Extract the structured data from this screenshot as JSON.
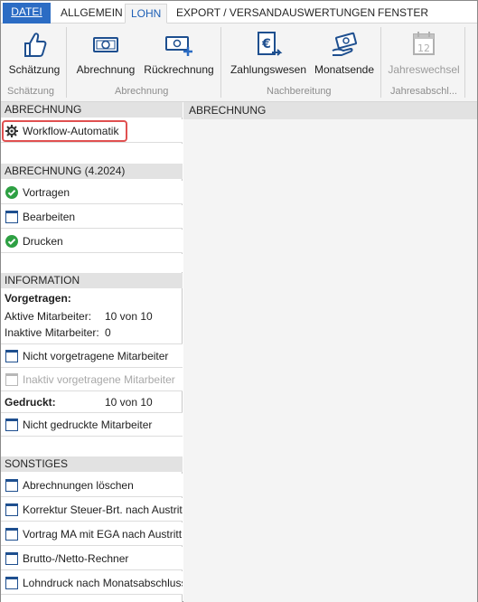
{
  "menu": {
    "tabs": [
      "DATEI",
      "ALLGEMEIN",
      "LOHN",
      "EXPORT / VERSAND",
      "AUSWERTUNGEN",
      "FENSTER"
    ]
  },
  "ribbon": {
    "buttons": {
      "schaetzung": "Schätzung",
      "abrechnung": "Abrechnung",
      "rueckrechnung": "Rückrechnung",
      "zahlungswesen": "Zahlungswesen",
      "monatsende": "Monatsende",
      "jahreswechsel": "Jahreswechsel"
    },
    "groups": {
      "schaetzung": "Schätzung",
      "abrechnung": "Abrechnung",
      "nachbereitung": "Nachbereitung",
      "jahresabschluss": "Jahresabschl..."
    },
    "calendar_number": "12"
  },
  "left": {
    "abrechnung_head": "ABRECHNUNG",
    "workflow": "Workflow-Automatik",
    "period_head": "ABRECHNUNG (4.2024)",
    "vortragen": "Vortragen",
    "bearbeiten": "Bearbeiten",
    "drucken": "Drucken",
    "info_head": "INFORMATION",
    "vorgetragen_label": "Vorgetragen:",
    "aktive_label": "Aktive Mitarbeiter:",
    "aktive_value": "10 von 10",
    "inaktive_label": "Inaktive Mitarbeiter:",
    "inaktive_value": "0",
    "nicht_vorgetragen": "Nicht vorgetragene Mitarbeiter",
    "inaktiv_vorgetragen": "Inaktiv vorgetragene Mitarbeiter",
    "gedruckt_label": "Gedruckt:",
    "gedruckt_value": "10 von 10",
    "nicht_gedruckt": "Nicht gedruckte Mitarbeiter",
    "sonstiges_head": "SONSTIGES",
    "loeschen": "Abrechnungen löschen",
    "korrektur": "Korrektur Steuer-Brt. nach Austritt",
    "vortrag_ega": "Vortrag MA mit EGA nach Austritt",
    "rechner": "Brutto-/Netto-Rechner",
    "lohndruck": "Lohndruck nach Monatsabschluss"
  },
  "right": {
    "head": "ABRECHNUNG"
  },
  "colors": {
    "accent": "#2b6cc4",
    "check_green": "#2ea043",
    "highlight_red": "#e05050",
    "section_gray": "#e2e2e2"
  }
}
